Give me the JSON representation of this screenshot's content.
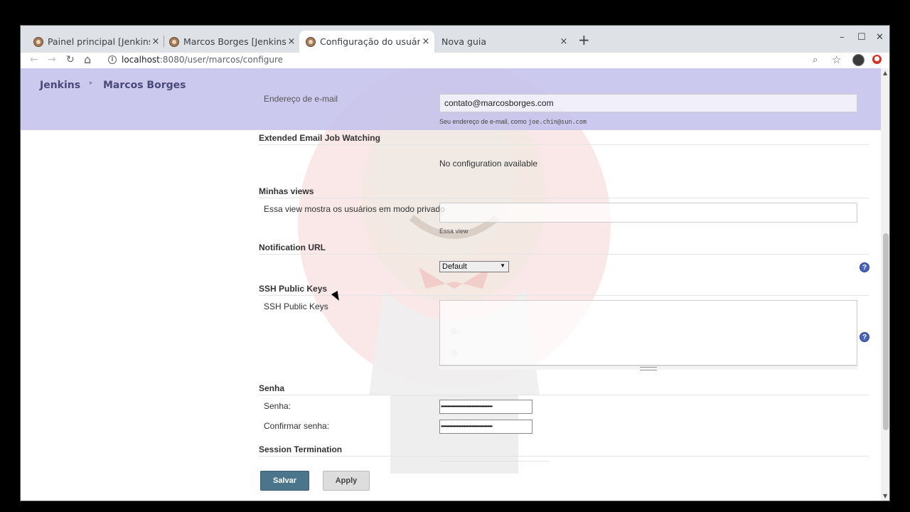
{
  "browser": {
    "tabs": [
      {
        "title": "Painel principal [Jenkins]",
        "active": false
      },
      {
        "title": "Marcos Borges [Jenkins]",
        "active": false
      },
      {
        "title": "Configuração do usuário",
        "active": true
      },
      {
        "title": "Nova guia",
        "active": false
      }
    ],
    "close_glyph": "×",
    "new_tab_glyph": "+",
    "window_controls": {
      "minimize": "–",
      "maximize": "☐",
      "close": "✕"
    },
    "nav": {
      "back": "←",
      "forward": "→",
      "reload": "↻",
      "home": "⌂"
    },
    "url_host": "localhost",
    "url_rest": ":8080/user/marcos/configure",
    "icons": [
      "zoom-icon",
      "star-icon",
      "profile-avatar",
      "extension-icon"
    ]
  },
  "breadcrumb": {
    "items": [
      "Jenkins",
      "Marcos Borges"
    ],
    "separator": "▸"
  },
  "form": {
    "email": {
      "label": "Endereço de e-mail",
      "value": "contato@marcosborges.com",
      "hint_prefix": "Seu endereço de e-mail, como ",
      "hint_example": "joe.chin@sun.com"
    },
    "extended_email": {
      "title": "Extended Email Job Watching",
      "message": "No configuration available"
    },
    "views": {
      "title": "Minhas views",
      "label": "Essa view mostra os usuários em modo privado",
      "value": "",
      "hint": "Essa view"
    },
    "notification": {
      "title": "Notification URL",
      "selected": "Default"
    },
    "ssh": {
      "title": "SSH Public Keys",
      "label": "SSH Public Keys",
      "value": ""
    },
    "password": {
      "title": "Senha",
      "label": "Senha:",
      "confirm_label": "Confirmar senha:",
      "masked": "••••••••••••••••••••••••••••••••••••••••"
    },
    "session": {
      "title": "Session Termination"
    },
    "buttons": {
      "save": "Salvar",
      "apply": "Apply"
    },
    "help_glyph": "?"
  },
  "colors": {
    "breadcrumb_bg": "#c4c2ec",
    "save_button": "#4b758b",
    "help_icon": "#4a63b8"
  }
}
